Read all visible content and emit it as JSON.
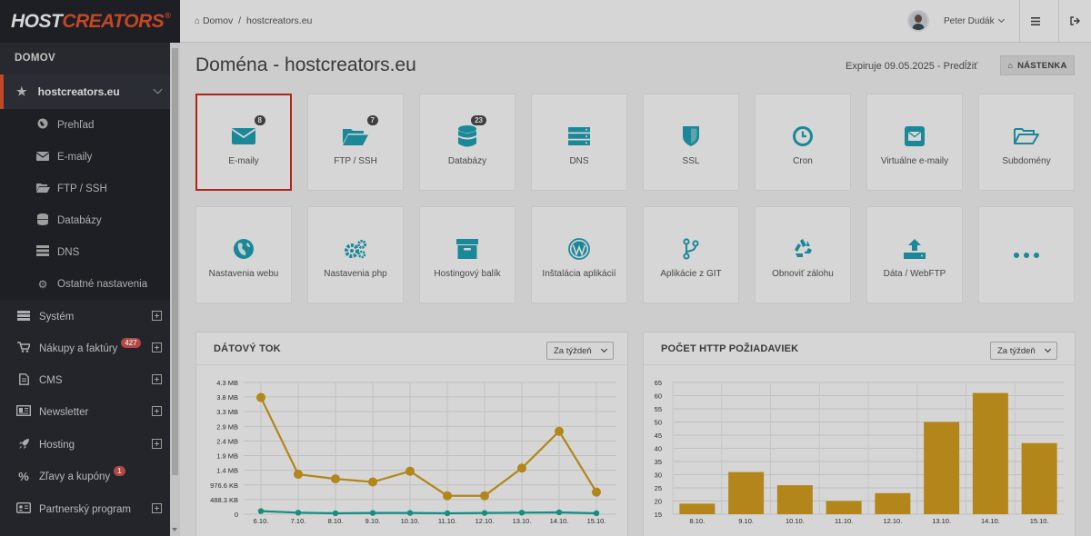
{
  "brand": {
    "logo_main": "HOST",
    "logo_accent": "CREATORS",
    "reg_mark": "®"
  },
  "sidebar": {
    "section_title": "DOMOV",
    "domain": "hostcreators.eu",
    "sub_items": [
      {
        "label": "Prehľad",
        "icon": "globe-icon"
      },
      {
        "label": "E-maily",
        "icon": "envelope-icon"
      },
      {
        "label": "FTP / SSH",
        "icon": "folder-open-icon"
      },
      {
        "label": "Databázy",
        "icon": "database-icon"
      },
      {
        "label": "DNS",
        "icon": "server-icon"
      },
      {
        "label": "Ostatné nastavenia",
        "icon": "gear-icon"
      }
    ],
    "main_items": [
      {
        "label": "Systém",
        "icon": "server-stack-icon",
        "badge": ""
      },
      {
        "label": "Nákupy a faktúry",
        "icon": "cart-icon",
        "badge": "427"
      },
      {
        "label": "CMS",
        "icon": "document-icon",
        "badge": ""
      },
      {
        "label": "Newsletter",
        "icon": "newspaper-icon",
        "badge": ""
      },
      {
        "label": "Hosting",
        "icon": "rocket-icon",
        "badge": ""
      },
      {
        "label": "Zľavy a kupóny",
        "icon": "percent-icon",
        "badge": "1"
      },
      {
        "label": "Partnerský program",
        "icon": "partner-card-icon",
        "badge": ""
      }
    ]
  },
  "topbar": {
    "breadcrumb_home": "Domov",
    "breadcrumb_sep": "/",
    "breadcrumb_current": "hostcreators.eu",
    "user_name": "Peter Dudák"
  },
  "page": {
    "title": "Doména - hostcreators.eu",
    "expiry_text": "Expiruje 09.05.2025 - Predĺžiť",
    "dashboard_button": "NÁSTENKA"
  },
  "tiles_row1": [
    {
      "label": "E-maily",
      "icon": "envelope-icon",
      "count": "8",
      "active": true
    },
    {
      "label": "FTP / SSH",
      "icon": "folder-open-icon",
      "count": "7",
      "active": false
    },
    {
      "label": "Databázy",
      "icon": "database-icon",
      "count": "23",
      "active": false
    },
    {
      "label": "DNS",
      "icon": "server-icon",
      "count": "",
      "active": false
    },
    {
      "label": "SSL",
      "icon": "shield-icon",
      "count": "",
      "active": false
    },
    {
      "label": "Cron",
      "icon": "clock-icon",
      "count": "",
      "active": false
    },
    {
      "label": "Virtuálne e-maily",
      "icon": "envelope-square-icon",
      "count": "",
      "active": false
    },
    {
      "label": "Subdomény",
      "icon": "folder-outline-icon",
      "count": "",
      "active": false
    }
  ],
  "tiles_row2": [
    {
      "label": "Nastavenia webu",
      "icon": "globe-icon"
    },
    {
      "label": "Nastavenia php",
      "icon": "gears-icon"
    },
    {
      "label": "Hostingový balík",
      "icon": "archive-box-icon"
    },
    {
      "label": "Inštalácia aplikácií",
      "icon": "wordpress-icon"
    },
    {
      "label": "Aplikácie z GIT",
      "icon": "git-branch-icon"
    },
    {
      "label": "Obnoviť zálohu",
      "icon": "recycle-icon"
    },
    {
      "label": "Dáta / WebFTP",
      "icon": "upload-icon"
    },
    {
      "label": "",
      "icon": "more-dots-icon"
    }
  ],
  "panels": {
    "traffic": {
      "title": "DÁTOVÝ TOK",
      "select": "Za týždeň"
    },
    "requests": {
      "title": "POČET HTTP POŽIADAVIEK",
      "select": "Za týždeň"
    }
  },
  "colors": {
    "accent": "#1fa3b5",
    "brand_orange": "#e8552b",
    "chart_gold": "#d4a020",
    "chart_teal": "#1aa898",
    "active_border": "#d9291c"
  },
  "chart_data": [
    {
      "type": "line",
      "title": "DÁTOVÝ TOK",
      "categories": [
        "6.10.",
        "7.10.",
        "8.10.",
        "9.10.",
        "10.10.",
        "11.10.",
        "12.10.",
        "13.10.",
        "14.10.",
        "15.10."
      ],
      "y_tick_labels": [
        "0",
        "488.3 KB",
        "976.6 KB",
        "1.4 MB",
        "1.9 MB",
        "2.4 MB",
        "2.9 MB",
        "3.3 MB",
        "3.8 MB",
        "4.3 MB"
      ],
      "y_tick_values_mb": [
        0,
        0.477,
        0.954,
        1.43,
        1.91,
        2.38,
        2.86,
        3.34,
        3.82,
        4.29
      ],
      "ylim_mb": [
        0,
        4.29
      ],
      "series": [
        {
          "values_mb": [
            3.8,
            1.3,
            1.15,
            1.05,
            1.4,
            0.6,
            0.6,
            1.5,
            2.7,
            0.72
          ]
        },
        {
          "values_mb": [
            0.1,
            0.05,
            0.03,
            0.04,
            0.04,
            0.03,
            0.04,
            0.05,
            0.06,
            0.03
          ]
        }
      ],
      "grid": true
    },
    {
      "type": "bar",
      "title": "POČET HTTP POŽIADAVIEK",
      "categories": [
        "8.10.",
        "9.10.",
        "10.10.",
        "11.10.",
        "12.10.",
        "13.10.",
        "14.10.",
        "15.10."
      ],
      "values": [
        19,
        31,
        26,
        20,
        23,
        50,
        61,
        42
      ],
      "y_ticks": [
        15,
        20,
        25,
        30,
        35,
        40,
        45,
        50,
        55,
        60,
        65
      ],
      "ylim": [
        15,
        65
      ],
      "grid": true
    }
  ]
}
